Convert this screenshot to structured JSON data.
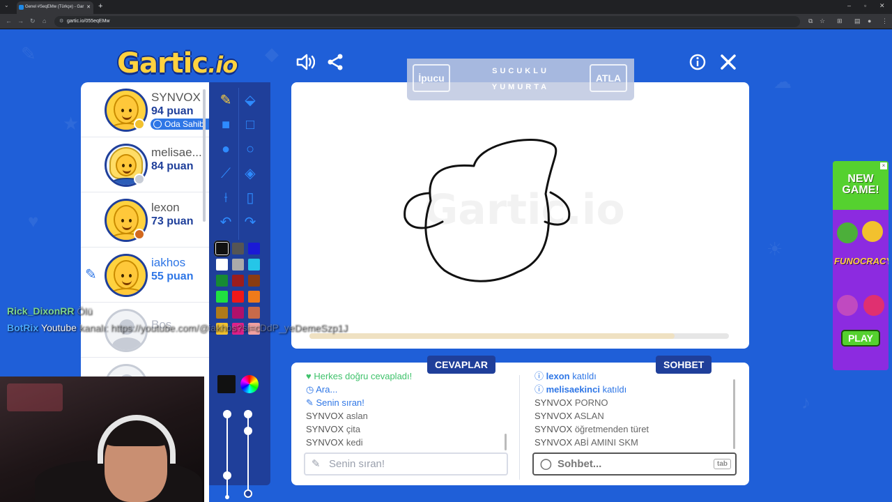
{
  "browser": {
    "tab_title": "Genel #SeqEMw (Türkçe) - Gar",
    "url": "gartic.io/055eqEMw"
  },
  "game": {
    "logo": "Gartic",
    "logo_suffix": ".io",
    "hint": {
      "tip_button": "İpucu",
      "word_line1": "SUCUKLU",
      "word_line2": "YUMURTA",
      "skip_button": "ATLA"
    },
    "players": [
      {
        "name": "SYNVOX",
        "points": "94 puan",
        "badge": "Oda Sahibi",
        "dot_color": "#f2c12e"
      },
      {
        "name": "melisae...",
        "points": "84 puan",
        "dot_color": "#c7ccd6"
      },
      {
        "name": "lexon",
        "points": "73 puan",
        "dot_color": "#d2691e"
      },
      {
        "name": "iakhos",
        "points": "55 puan",
        "drawing": true
      },
      {
        "name": "Boş",
        "points": ""
      }
    ],
    "palette": [
      "#111111",
      "#555555",
      "#1a1ad6",
      "#ffffff",
      "#aaaaaa",
      "#25c6e8",
      "#168a34",
      "#9b1d1d",
      "#8a3c12",
      "#20e040",
      "#f01818",
      "#f07a1a",
      "#b07a1a",
      "#b0106a",
      "#c86a4a",
      "#f2c12e",
      "#e0208a",
      "#f0a0a0"
    ],
    "timer_fraction": 0.87,
    "answers_tab": "CEVAPLAR",
    "chat_tab": "SOHBET",
    "answers": [
      {
        "type": "system-green",
        "text": "Herkes doğru cevapladı!"
      },
      {
        "type": "system-blue",
        "text": "Ara..."
      },
      {
        "type": "system-blue",
        "text": "Senin sıran!"
      },
      {
        "name": "SYNVOX",
        "text": "aslan"
      },
      {
        "name": "SYNVOX",
        "text": "çita"
      },
      {
        "name": "SYNVOX",
        "text": "kedi"
      }
    ],
    "chat": [
      {
        "type": "join",
        "name": "lexon",
        "text": "katıldı"
      },
      {
        "type": "join",
        "name": "melisaekinci",
        "text": "katıldı"
      },
      {
        "name": "SYNVOX",
        "text": "PORNO"
      },
      {
        "name": "SYNVOX",
        "text": "ASLAN"
      },
      {
        "name": "SYNVOX",
        "text": "öğretmenden türet"
      },
      {
        "name": "SYNVOX",
        "text": "ABİ AMINI SKM"
      }
    ],
    "answer_placeholder": "Senin sıran!",
    "chat_placeholder": "Sohbet...",
    "chat_key_hint": "tab"
  },
  "ad": {
    "headline1": "NEW",
    "headline2": "GAME!",
    "brand": "FUNOCRACY",
    "cta": "PLAY"
  },
  "stream_overlay": {
    "line1_name": "Rick_DixonRR",
    "line1_text": "Ölü",
    "line2_name": "BotRix",
    "line2_text": "Youtube",
    "line2_faded": "kanalı: https://youtube.com/@iakhos?si=cDdP_yeDemeSzp1J"
  }
}
